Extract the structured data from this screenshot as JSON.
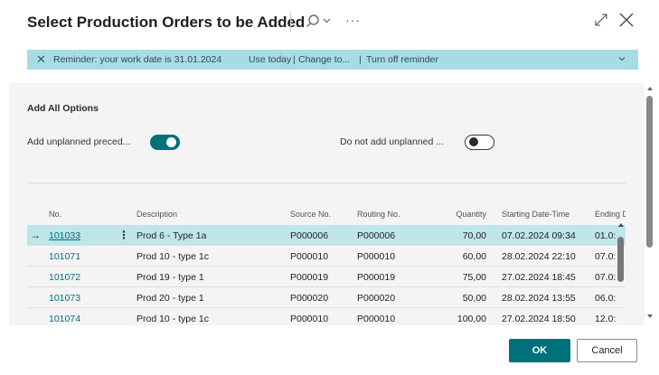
{
  "dialog": {
    "title": "Select Production Orders to be Added",
    "more_label": "···"
  },
  "reminder": {
    "message": "Reminder: your work date is 31.01.2024",
    "use_today": "Use today",
    "change_to": "Change to...",
    "turn_off": "Turn off reminder",
    "separator": "|"
  },
  "options": {
    "section_title": "Add All Options",
    "add_unplanned_label": "Add unplanned preced...",
    "add_unplanned_on": true,
    "do_not_add_label": "Do not add unplanned ...",
    "do_not_add_on": false
  },
  "table": {
    "columns": [
      "No.",
      "Description",
      "Source No.",
      "Routing No.",
      "Quantity",
      "Starting Date-Time",
      "Ending D"
    ],
    "rows": [
      {
        "no": "101033",
        "description": "Prod 6 - Type 1a",
        "source_no": "P000006",
        "routing_no": "P000006",
        "quantity": "70,00",
        "starting": "07.02.2024 09:34",
        "ending": "01.0:",
        "selected": true
      },
      {
        "no": "101071",
        "description": "Prod 10 - type 1c",
        "source_no": "P000010",
        "routing_no": "P000010",
        "quantity": "60,00",
        "starting": "28.02.2024 22:10",
        "ending": "07.0:"
      },
      {
        "no": "101072",
        "description": "Prod 19 - type 1",
        "source_no": "P000019",
        "routing_no": "P000019",
        "quantity": "75,00",
        "starting": "27.02.2024 18:45",
        "ending": "07.0:"
      },
      {
        "no": "101073",
        "description": "Prod 20 - type 1",
        "source_no": "P000020",
        "routing_no": "P000020",
        "quantity": "50,00",
        "starting": "28.02.2024 13:55",
        "ending": "06.0:"
      },
      {
        "no": "101074",
        "description": "Prod 10 - type 1c",
        "source_no": "P000010",
        "routing_no": "P000010",
        "quantity": "100,00",
        "starting": "27.02.2024 18:50",
        "ending": "12.0:"
      }
    ]
  },
  "buttons": {
    "ok": "OK",
    "cancel": "Cancel"
  },
  "colors": {
    "accent": "#00707a",
    "reminder_bg": "#a6dde3",
    "selected_row": "#bfe5ea",
    "panel_bg": "#f4f4f4"
  },
  "icons": [
    "search-icon",
    "chevron-down-icon",
    "more-icon",
    "expand-icon",
    "close-icon",
    "arrow-right-icon"
  ]
}
